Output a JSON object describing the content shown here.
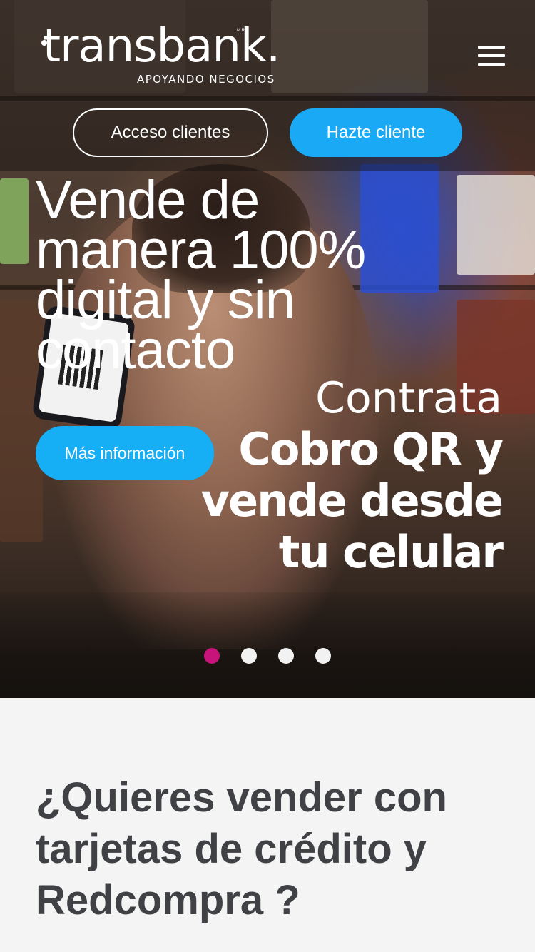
{
  "header": {
    "logo_text": "transbank.",
    "logo_tm": "M.R",
    "tagline": "APOYANDO NEGOCIOS",
    "menu_icon": "hamburger-menu-icon"
  },
  "actions": {
    "login_label": "Acceso clientes",
    "signup_label": "Hazte cliente"
  },
  "hero": {
    "title": "Vende de manera 100% digital y sin contacto",
    "promo_lines": [
      "Contrata",
      "Cobro QR y",
      "vende desde",
      "tu celular"
    ],
    "cta_label": "Más información",
    "slides": {
      "count": 4,
      "active": 0
    }
  },
  "section": {
    "title": "¿Quieres vender con tarjetas de crédito y Redcompra ?"
  },
  "colors": {
    "primary_blue": "#1aa9f4",
    "active_dot": "#c6147a",
    "heading_gray": "#3f4145",
    "section_bg": "#f4f4f5"
  }
}
